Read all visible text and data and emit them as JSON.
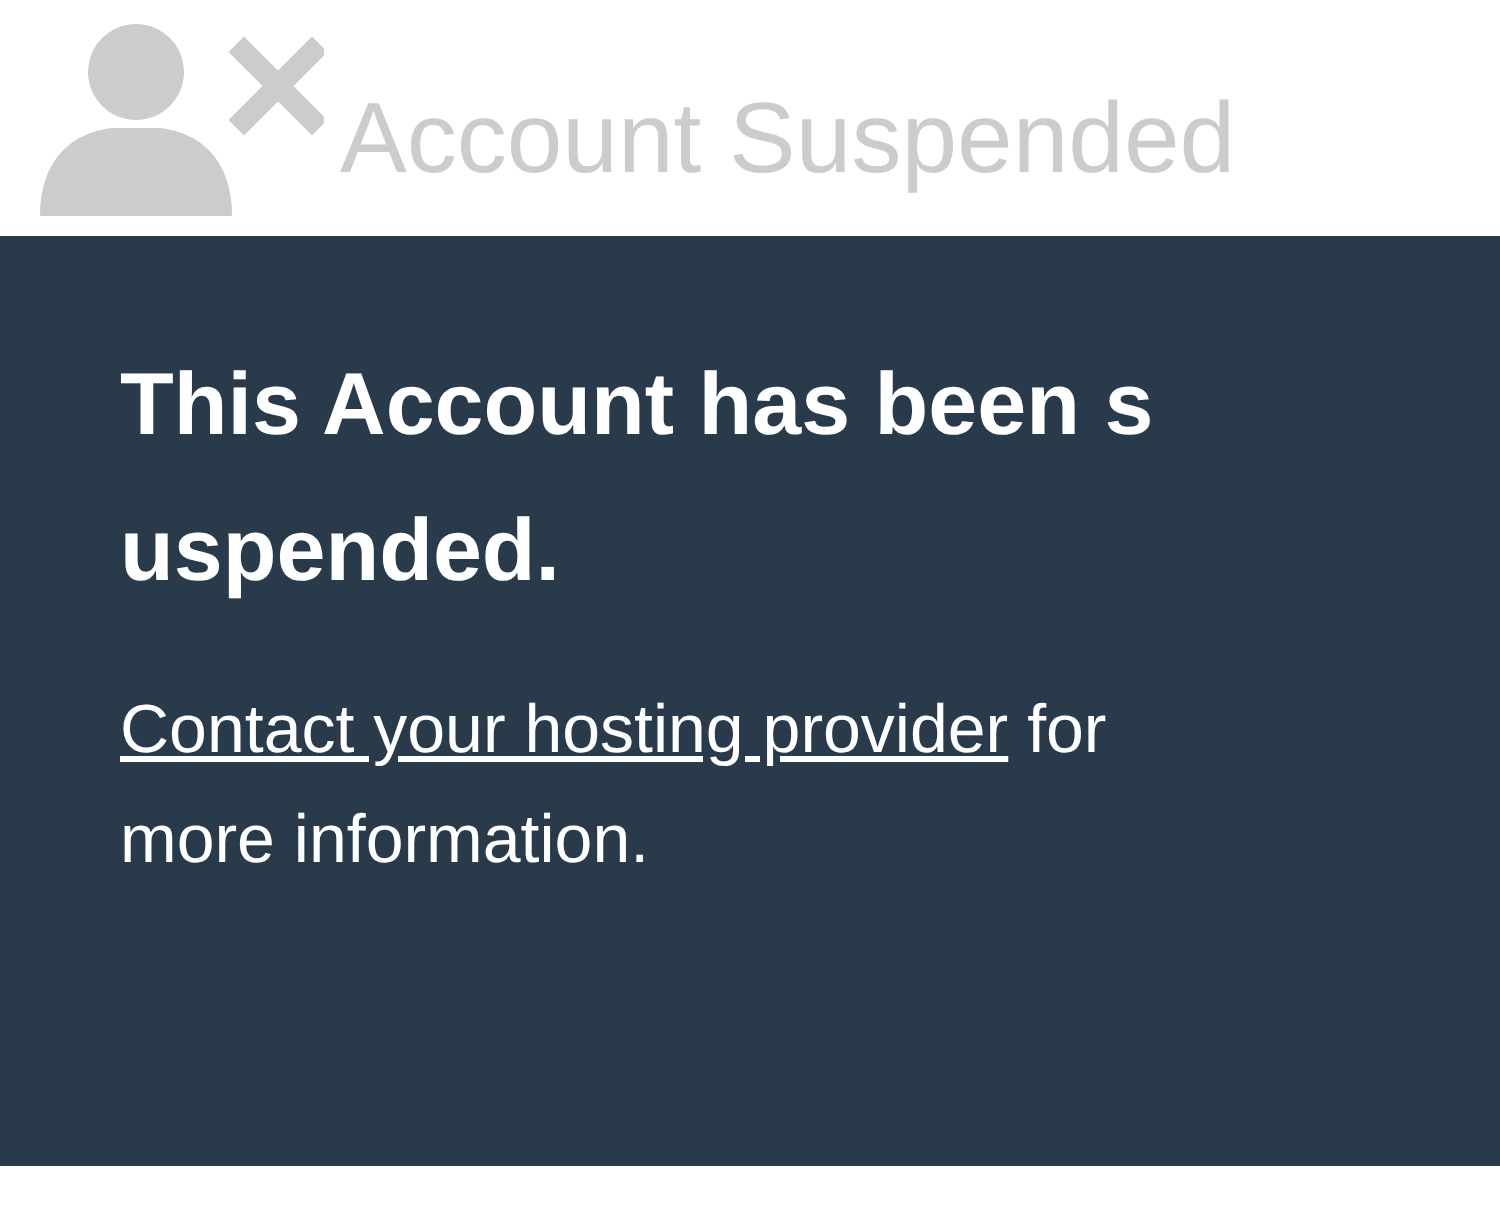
{
  "header": {
    "title": "Account Suspended"
  },
  "panel": {
    "heading": "This Account has been suspended.",
    "link": "Contact your hosting provider",
    "text_after": " for more information."
  }
}
